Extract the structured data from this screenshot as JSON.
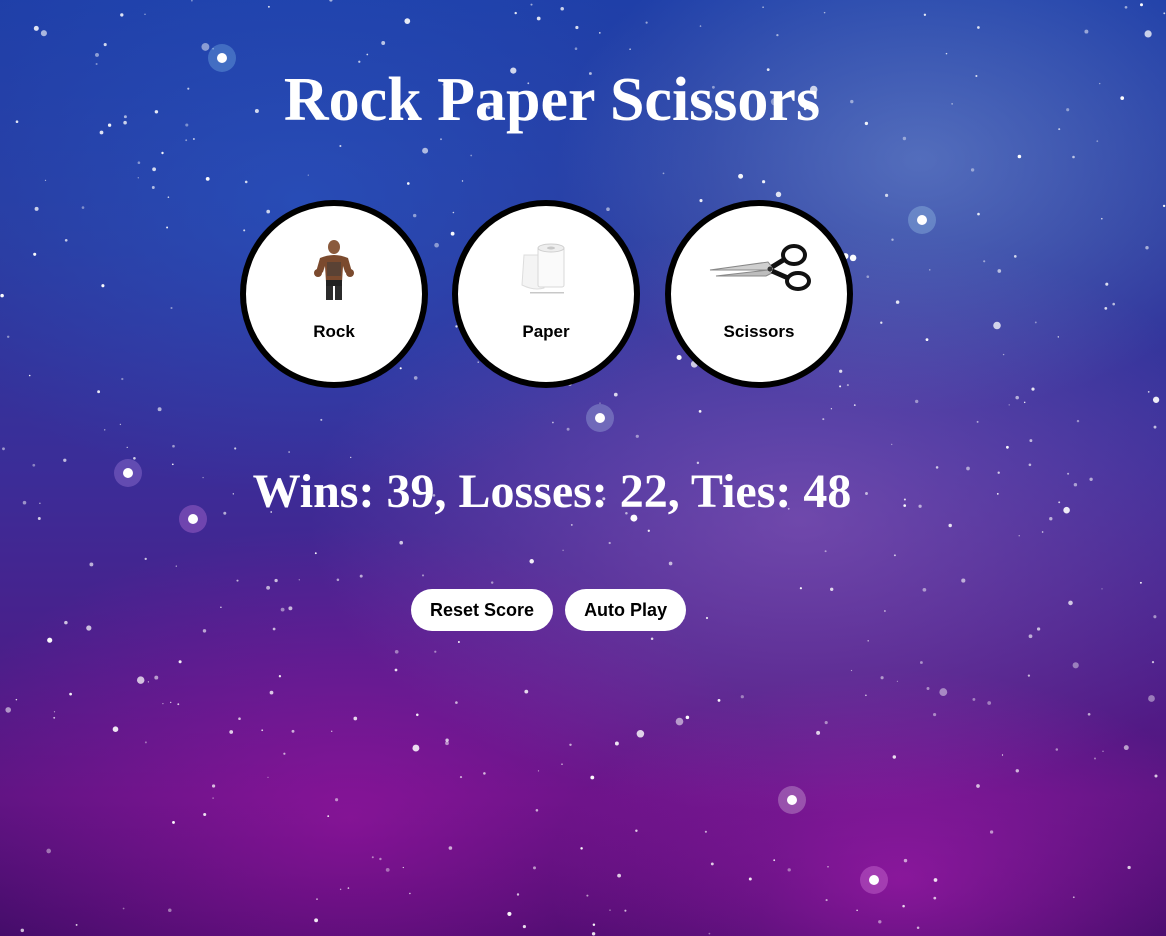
{
  "page": {
    "title": "Rock Paper Scissors"
  },
  "choices": [
    {
      "label": "Rock",
      "icon": "rock-wrestler-icon"
    },
    {
      "label": "Paper",
      "icon": "toilet-paper-roll-icon"
    },
    {
      "label": "Scissors",
      "icon": "scissors-icon"
    }
  ],
  "score": {
    "text": "Wins: 39, Losses: 22, Ties: 48",
    "wins": 39,
    "losses": 22,
    "ties": 48
  },
  "controls": {
    "reset_label": "Reset Score",
    "autoplay_label": "Auto Play"
  },
  "colors": {
    "background": "#2a3a9e",
    "button_bg": "#ffffff",
    "choice_border": "#000000",
    "text": "#ffffff"
  }
}
